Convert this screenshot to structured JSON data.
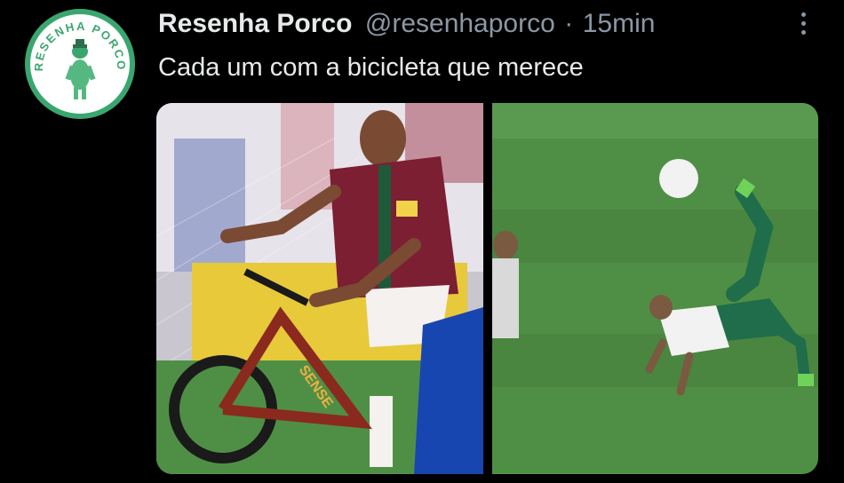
{
  "tweet": {
    "author_name": "Resenha Porco",
    "author_handle": "@resenhaporco",
    "separator": "·",
    "timestamp": "15min",
    "text": "Cada um com a bicicleta que merece",
    "more_icon": "more-vertical-icon"
  },
  "avatar": {
    "logo_text": "RESENHA PORCO",
    "background": "#3aa66f"
  },
  "media": {
    "left_photo_bike_brand": "SENSE"
  },
  "colors": {
    "background": "#000000",
    "primary_text": "#e7e9ea",
    "secondary_text": "#8b98a5",
    "pitch_green": "#4f8f45"
  }
}
